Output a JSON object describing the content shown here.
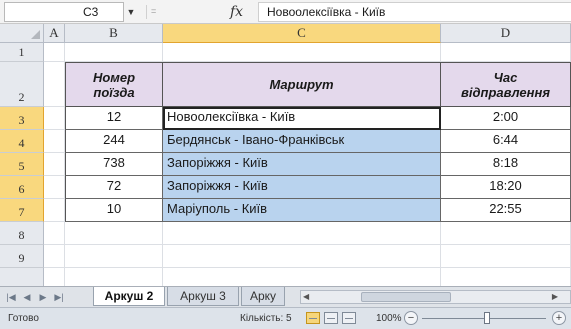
{
  "formula_bar": {
    "name_box": "C3",
    "fx_label": "fx",
    "content": "Новоолексіївка - Київ"
  },
  "columns": [
    "A",
    "B",
    "C",
    "D"
  ],
  "rows": [
    "1",
    "2",
    "3",
    "4",
    "5",
    "6",
    "7",
    "8",
    "9"
  ],
  "table": {
    "headers": {
      "number_line1": "Номер",
      "number_line2": "поїзда",
      "route": "Маршрут",
      "time_line1": "Час",
      "time_line2": "відправлення"
    },
    "rows": [
      {
        "number": "12",
        "route": "Новоолексіївка - Київ",
        "time": "2:00"
      },
      {
        "number": "244",
        "route": "Бердянськ - Івано-Франківськ",
        "time": "6:44"
      },
      {
        "number": "738",
        "route": "Запоріжжя - Київ",
        "time": "8:18"
      },
      {
        "number": "72",
        "route": "Запоріжжя - Київ",
        "time": "18:20"
      },
      {
        "number": "10",
        "route": "Маріуполь - Київ",
        "time": "22:55"
      }
    ]
  },
  "sheet_tabs": [
    "Аркуш 2",
    "Аркуш 3",
    "Арку"
  ],
  "status_bar": {
    "ready": "Готово",
    "count": "Кількість: 5",
    "zoom": "100%"
  },
  "colors": {
    "selection_blue": "#b9d3ee",
    "header_lilac": "#e4d9ec",
    "selected_header": "#f9d87e"
  }
}
